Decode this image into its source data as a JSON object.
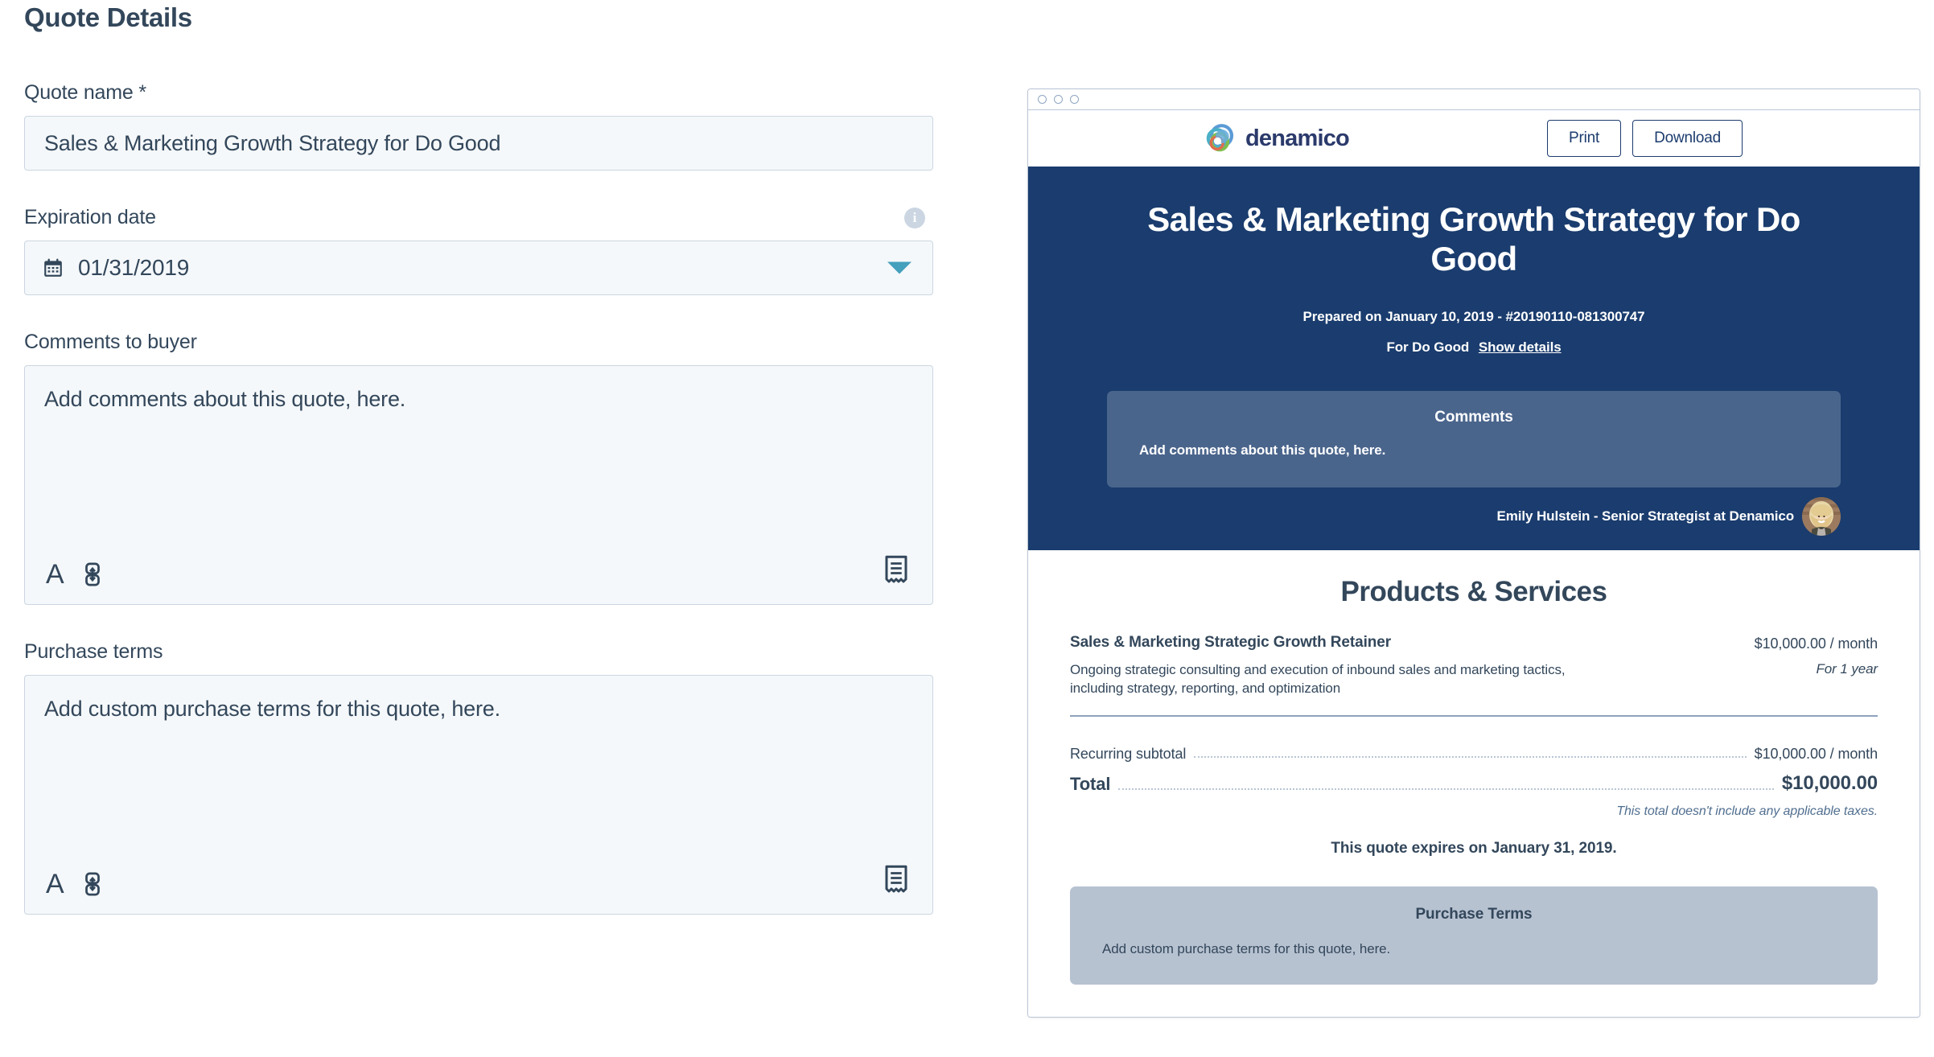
{
  "form": {
    "page_title": "Quote Details",
    "quote_name": {
      "label": "Quote name *",
      "value": "Sales & Marketing Growth Strategy for Do Good"
    },
    "expiration_date": {
      "label": "Expiration date",
      "value": "01/31/2019",
      "info_icon": "info-icon",
      "calendar_icon": "calendar-icon",
      "caret_icon": "chevron-down-icon"
    },
    "comments_to_buyer": {
      "label": "Comments to buyer",
      "placeholder": "Add comments about this quote, here.",
      "font_icon": "font-format-icon",
      "link_icon": "link-icon",
      "snippet_icon": "snippet-icon"
    },
    "purchase_terms": {
      "label": "Purchase terms",
      "placeholder": "Add custom purchase terms for this quote, here.",
      "font_icon": "font-format-icon",
      "link_icon": "link-icon",
      "snippet_icon": "snippet-icon"
    }
  },
  "preview": {
    "window_dots": [
      "dot-1",
      "dot-2",
      "dot-3"
    ],
    "brand": {
      "logo_icon": "denamico-logo-icon",
      "wordmark": "denamico"
    },
    "actions": {
      "print": "Print",
      "download": "Download"
    },
    "hero": {
      "title": "Sales & Marketing Growth Strategy for Do Good",
      "prepared": "Prepared on January 10, 2019 - #20190110-081300747",
      "for_label": "For Do Good",
      "show_details_link": "Show details"
    },
    "comments_card": {
      "title": "Comments",
      "body": "Add comments about this quote, here."
    },
    "rep": {
      "name": "Emily Hulstein - Senior Strategist at Denamico",
      "avatar_icon": "avatar"
    },
    "products": {
      "section_title": "Products & Services",
      "items": [
        {
          "name": "Sales & Marketing Strategic Growth Retainer",
          "description": "Ongoing strategic consulting and execution of inbound sales and marketing tactics, including strategy, reporting, and optimization",
          "price": "$10,000.00 / month",
          "term": "For 1 year"
        }
      ]
    },
    "totals": {
      "rows": [
        {
          "label": "Recurring subtotal",
          "value": "$10,000.00 / month"
        },
        {
          "label": "Total",
          "value": "$10,000.00"
        }
      ],
      "tax_note": "This total doesn't include any applicable taxes.",
      "expires_note": "This quote expires on January 31, 2019."
    },
    "terms_card": {
      "title": "Purchase Terms",
      "body": "Add custom purchase terms for this quote, here."
    }
  },
  "colors": {
    "navy": "#1a3c6e",
    "comments_card": "#4a658c",
    "terms_card": "#b7c2d1",
    "input_bg": "#f5f8fa",
    "input_border": "#cbd6e2",
    "text": "#33475b",
    "teal_caret": "#44a0bd"
  }
}
